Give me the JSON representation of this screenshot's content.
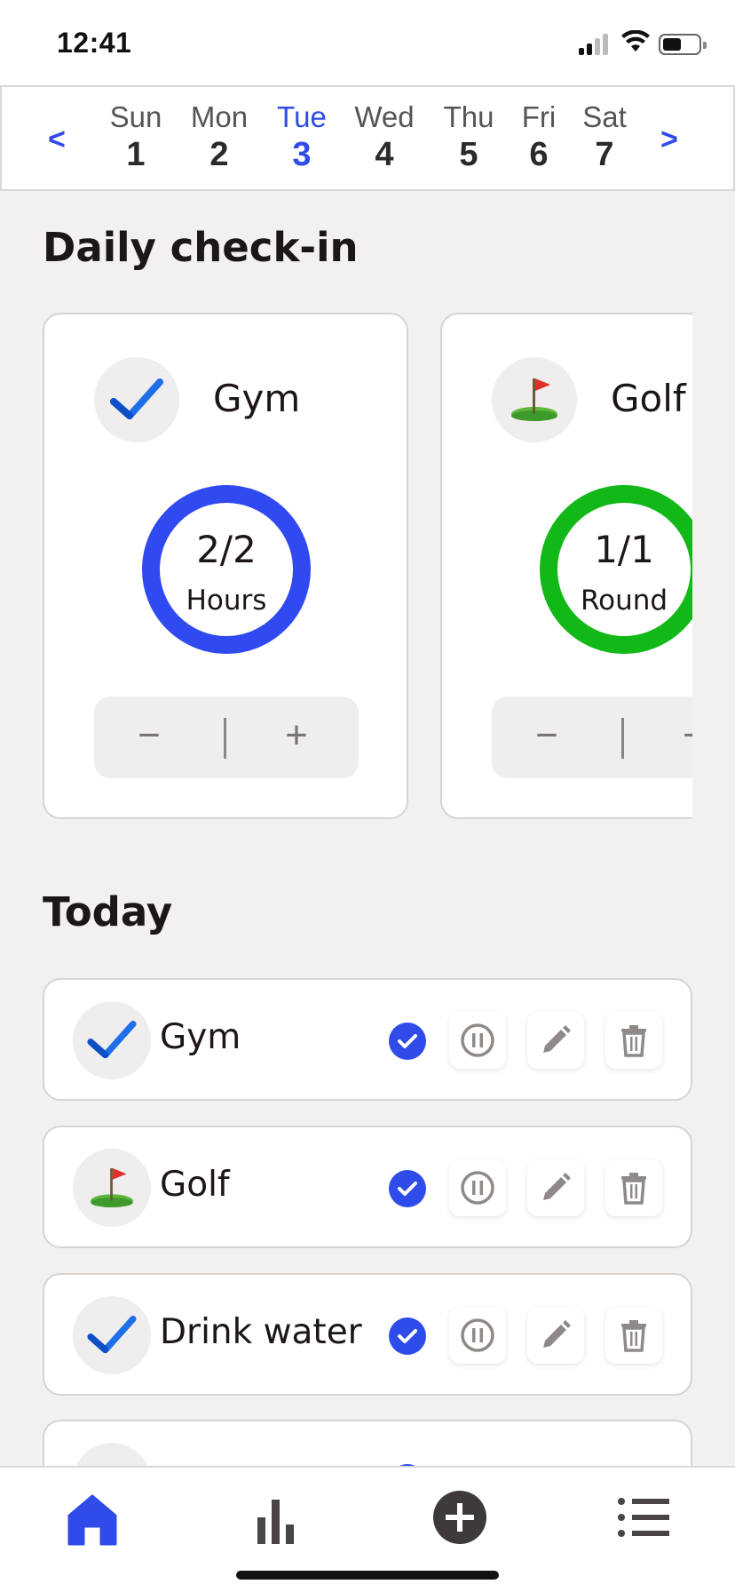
{
  "status_bar": {
    "time": "12:41",
    "icons": [
      "signal-icon",
      "wifi-icon",
      "battery-icon"
    ]
  },
  "week": {
    "prev_label": "<",
    "next_label": ">",
    "days": [
      {
        "name": "Sun",
        "num": "1"
      },
      {
        "name": "Mon",
        "num": "2"
      },
      {
        "name": "Tue",
        "num": "3"
      },
      {
        "name": "Wed",
        "num": "4"
      },
      {
        "name": "Thu",
        "num": "5"
      },
      {
        "name": "Fri",
        "num": "6"
      },
      {
        "name": "Sat",
        "num": "7"
      }
    ],
    "selected_day": "Tue",
    "accent_color": "#2f4be9"
  },
  "checkin": {
    "title": "Daily check-in",
    "cards": [
      {
        "name": "Gym",
        "icon": "blue-check-icon",
        "value": "2/2",
        "unit": "Hours",
        "progress": 1.0,
        "ring_color": "#3049f0",
        "minus": "−",
        "plus": "+"
      },
      {
        "name": "Golf",
        "icon": "golf-flag-icon",
        "value": "1/1",
        "unit": "Round",
        "progress": 1.0,
        "ring_color": "#12b818",
        "minus": "−",
        "plus": "+"
      }
    ]
  },
  "today": {
    "title": "Today",
    "items": [
      {
        "name": "Gym",
        "icon": "blue-check-icon",
        "done": true
      },
      {
        "name": "Golf",
        "icon": "golf-flag-icon",
        "done": true
      },
      {
        "name": "Drink water",
        "icon": "blue-check-icon",
        "done": true
      }
    ],
    "actions": [
      "pause-icon",
      "edit-icon",
      "delete-icon"
    ]
  },
  "bottom_nav": {
    "items": [
      "home-icon",
      "stats-icon",
      "add-icon",
      "list-icon"
    ],
    "active": "home-icon"
  }
}
